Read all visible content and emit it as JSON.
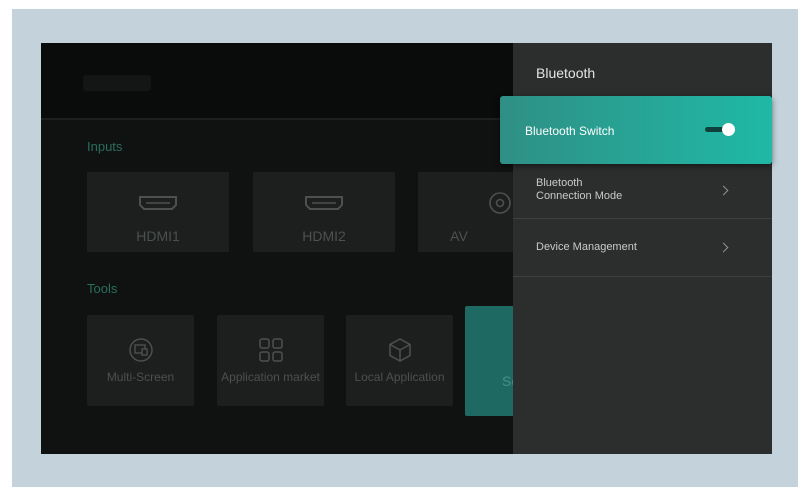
{
  "home": {
    "inputs_label": "Inputs",
    "inputs": [
      {
        "label": "HDMI1",
        "icon": "hdmi-port-icon"
      },
      {
        "label": "HDMI2",
        "icon": "hdmi-port-icon"
      },
      {
        "label": "AV",
        "icon": "av-port-icon"
      }
    ],
    "tools_label": "Tools",
    "tools": [
      {
        "label": "Multi-Screen",
        "icon": "multi-screen-icon"
      },
      {
        "label": "Application market",
        "icon": "app-grid-icon"
      },
      {
        "label": "Local Application",
        "icon": "cube-icon"
      },
      {
        "label": "Se"
      }
    ]
  },
  "panel": {
    "title": "Bluetooth",
    "switch_label": "Bluetooth Switch",
    "switch_on": true,
    "connection_mode_line1": "Bluetooth",
    "connection_mode_line2": "Connection Mode",
    "device_management": "Device Management"
  },
  "colors": {
    "accent": "#1fb9a6",
    "panel_bg": "#2c2d2d",
    "frame_bg": "#c3d2db"
  }
}
